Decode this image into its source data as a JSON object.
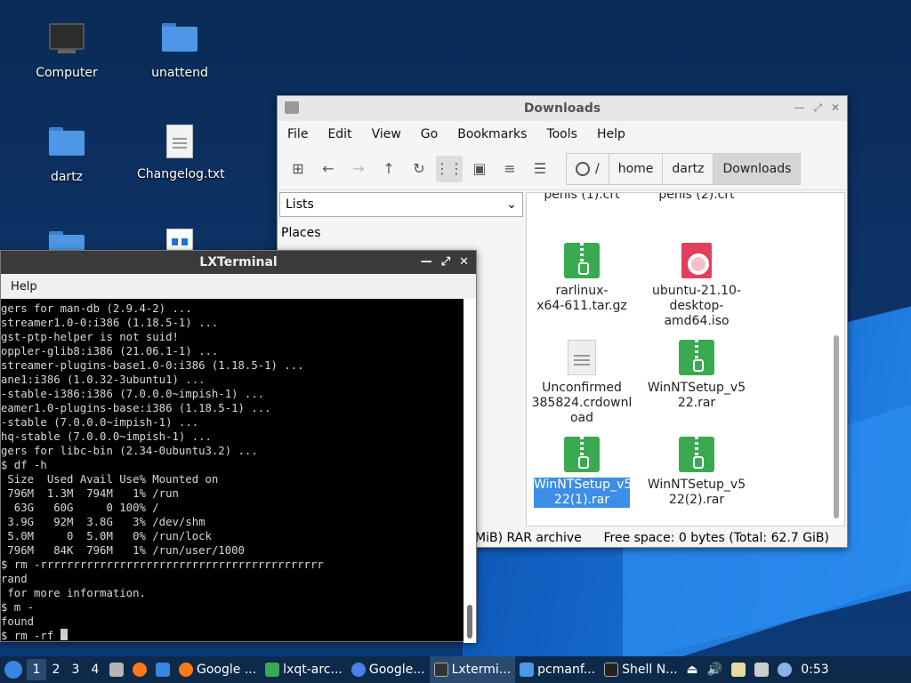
{
  "desktop": {
    "icons": [
      {
        "label": "Computer"
      },
      {
        "label": "unattend"
      },
      {
        "label": "dartz"
      },
      {
        "label": "Changelog.txt"
      }
    ]
  },
  "file_manager": {
    "title": "Downloads",
    "menu": [
      "File",
      "Edit",
      "View",
      "Go",
      "Bookmarks",
      "Tools",
      "Help"
    ],
    "path_root": "/",
    "breadcrumbs": [
      "home",
      "dartz",
      "Downloads"
    ],
    "sidebar_select": "Lists",
    "sidebar_heading": "Places",
    "partial_files": [
      "penis (1).crt",
      "penis (2).crt"
    ],
    "files": [
      {
        "name": "rarlinux-x64-611.tar.gz",
        "l1": "rarlinux-",
        "l2": "x64-611.tar.gz",
        "l3": "",
        "icon": "archive-icon"
      },
      {
        "name": "ubuntu-21.10-desktop-amd64.iso",
        "l1": "ubuntu-21.10-",
        "l2": "desktop-",
        "l3": "amd64.iso",
        "icon": "disc-image-icon"
      },
      {
        "name": "Unconfirmed 385824.crdownload",
        "l1": "Unconfirmed",
        "l2": "385824.crdownl",
        "l3": "oad",
        "icon": "document-icon"
      },
      {
        "name": "WinNTSetup_v522.rar",
        "l1": "WinNTSetup_v5",
        "l2": "22.rar",
        "l3": "",
        "icon": "archive-icon"
      },
      {
        "name": "WinNTSetup_v522(1).rar",
        "l1": "WinNTSetup_v5",
        "l2": "22(1).rar",
        "l3": "",
        "icon": "archive-icon",
        "selected": true
      },
      {
        "name": "WinNTSetup_v522(2).rar",
        "l1": "WinNTSetup_v5",
        "l2": "22(2).rar",
        "l3": "",
        "icon": "archive-icon"
      }
    ],
    "status_left": "MiB) RAR archive",
    "status_right": "Free space: 0 bytes (Total: 62.7 GiB)"
  },
  "terminal": {
    "title": "LXTerminal",
    "menu": [
      "Help"
    ],
    "lines": [
      "gers for man-db (2.9.4-2) ...",
      "streamer1.0-0:i386 (1.18.5-1) ...",
      "gst-ptp-helper is not suid!",
      "oppler-glib8:i386 (21.06.1-1) ...",
      "streamer-plugins-base1.0-0:i386 (1.18.5-1) ...",
      "ane1:i386 (1.0.32-3ubuntu1) ...",
      "-stable-i386:i386 (7.0.0.0~impish-1) ...",
      "eamer1.0-plugins-base:i386 (1.18.5-1) ...",
      "-stable (7.0.0.0~impish-1) ...",
      "hq-stable (7.0.0.0~impish-1) ...",
      "gers for libc-bin (2.34-0ubuntu3.2) ...",
      "$ df -h",
      " Size  Used Avail Use% Mounted on",
      " 796M  1.3M  794M   1% /run",
      "  63G   60G     0 100% /",
      " 3.9G   92M  3.8G   3% /dev/shm",
      " 5.0M     0  5.0M   0% /run/lock",
      " 796M   84K  796M   1% /run/user/1000",
      "$ rm -rrrrrrrrrrrrrrrrrrrrrrrrrrrrrrrrrrrrrrrrrrr",
      "rand",
      " for more information.",
      "$ m -",
      "found"
    ],
    "prompt": "$ rm -rf "
  },
  "taskbar": {
    "workspaces": [
      "1",
      "2",
      "3",
      "4"
    ],
    "tasks": [
      "Google ...",
      "lxqt-arc...",
      "Google...",
      "Lxtermi...",
      "pcmanf...",
      "Shell N..."
    ],
    "clock": "0:53"
  }
}
